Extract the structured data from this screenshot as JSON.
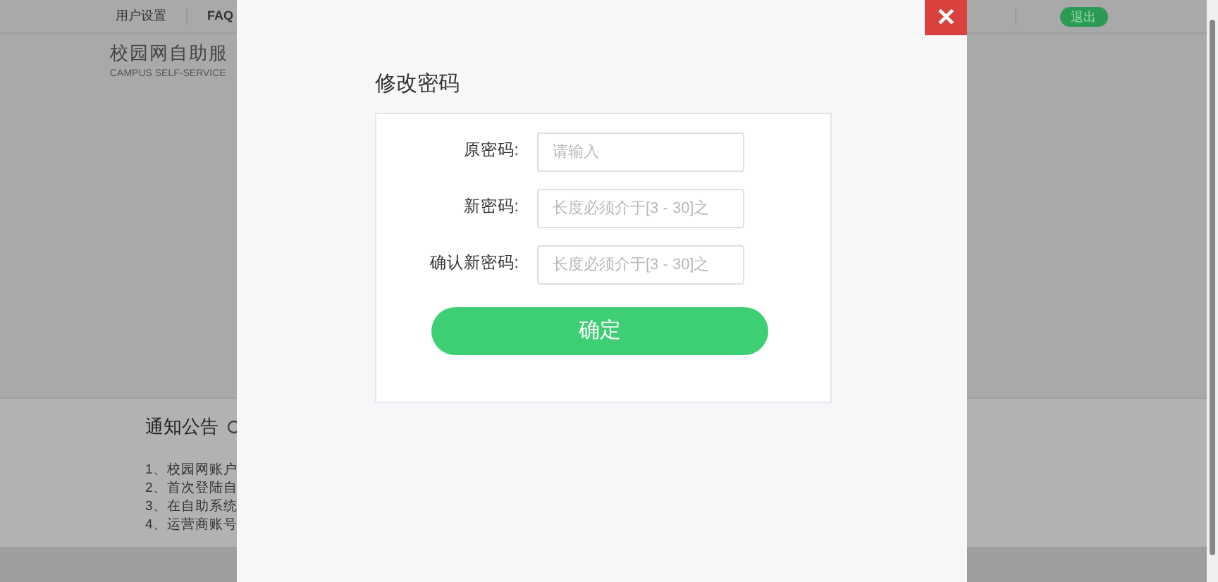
{
  "nav": {
    "items": [
      "用户设置",
      "FAQ"
    ],
    "logout": "退出"
  },
  "header": {
    "title": "校园网自助服",
    "subtitle": "CAMPUS SELF-SERVICE"
  },
  "notices": {
    "title": "通知公告",
    "items": [
      "1、校园网账户",
      "2、首次登陆自",
      "3、在自助系统",
      "4、运营商账号"
    ]
  },
  "dialog": {
    "close": "✕",
    "title": "修改密码",
    "fields": [
      {
        "label": "原密码:",
        "placeholder": "请输入"
      },
      {
        "label": "新密码:",
        "placeholder": "长度必须介于[3 - 30]之"
      },
      {
        "label": "确认新密码:",
        "placeholder": "长度必须介于[3 - 30]之"
      }
    ],
    "submit": "确定"
  }
}
